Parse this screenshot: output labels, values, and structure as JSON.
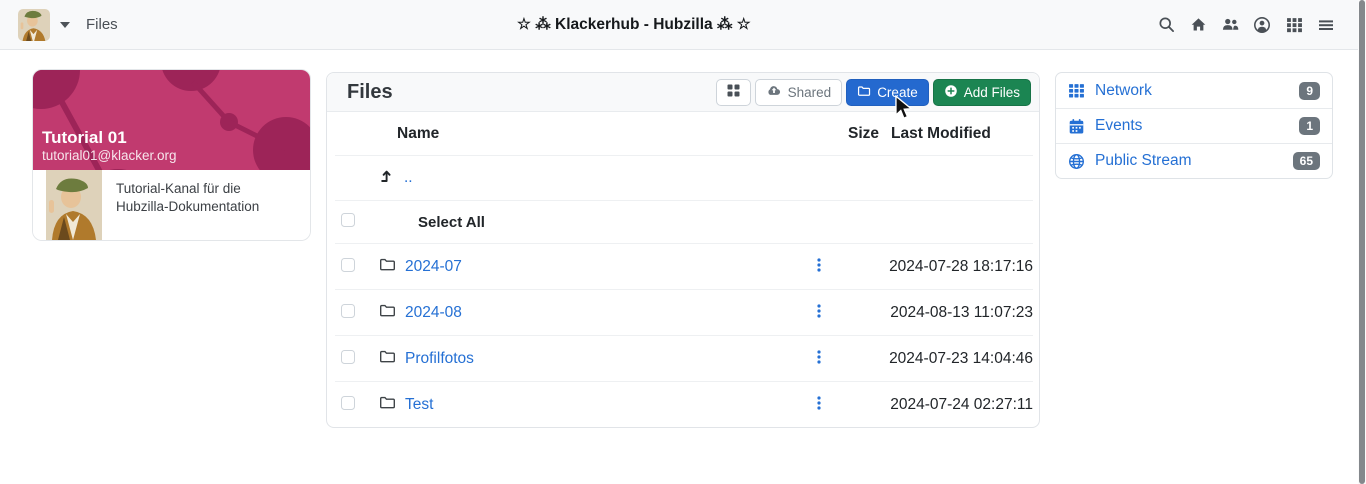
{
  "navbar": {
    "app_label": "Files",
    "title": "☆ ⁂ Klackerhub - Hubzilla ⁂ ☆",
    "icons": [
      "channel-avatar-menu",
      "search",
      "home",
      "groups",
      "account",
      "apps-grid",
      "menu"
    ]
  },
  "profile_card": {
    "name": "Tutorial 01",
    "address": "tutorial01@klacker.org",
    "description": "Tutorial-Kanal für die Hubzilla-Dokumentation"
  },
  "files_panel": {
    "title": "Files",
    "toolbar": {
      "view_toggle_icon": "grid-view",
      "shared_label": "Shared",
      "create_label": "Create",
      "add_files_label": "Add Files"
    },
    "table": {
      "headers": {
        "name": "Name",
        "size": "Size",
        "modified": "Last Modified"
      },
      "parent_link_label": "..",
      "select_all_label": "Select All",
      "rows": [
        {
          "name": "2024-07",
          "type": "folder",
          "size": "",
          "modified": "2024-07-28 18:17:16"
        },
        {
          "name": "2024-08",
          "type": "folder",
          "size": "",
          "modified": "2024-08-13 11:07:23"
        },
        {
          "name": "Profilfotos",
          "type": "folder",
          "size": "",
          "modified": "2024-07-23 14:04:46"
        },
        {
          "name": "Test",
          "type": "folder",
          "size": "",
          "modified": "2024-07-24 02:27:11"
        }
      ]
    }
  },
  "right_sidebar": {
    "items": [
      {
        "label": "Network",
        "count": "9",
        "icon": "grid-3x3"
      },
      {
        "label": "Events",
        "count": "1",
        "icon": "calendar"
      },
      {
        "label": "Public Stream",
        "count": "65",
        "icon": "globe"
      }
    ]
  },
  "colors": {
    "link_blue": "#2570d4",
    "button_blue": "#2469cf",
    "button_green": "#1b8552",
    "badge_gray": "#6c757d",
    "banner_pink": "#c13a6f",
    "banner_dark_pink": "#9d2458",
    "navbar_bg": "#f8f9fa"
  }
}
